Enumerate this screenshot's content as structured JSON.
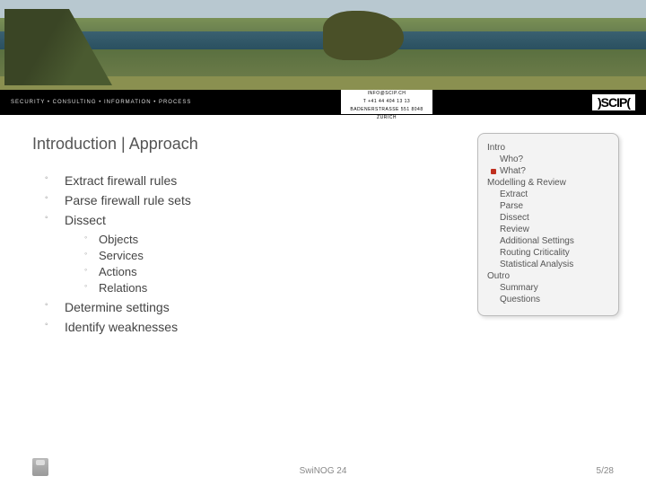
{
  "brand": {
    "tagline": "SECURITY • CONSULTING • INFORMATION • PROCESS",
    "line1": "INFO@SCIP.CH",
    "line2": "T +41 44 404 13 13",
    "line3": "BADENERSTRASSE 551 8048 ZÜRICH",
    "logo": ")SCIP("
  },
  "title": "Introduction | Approach",
  "bullets": {
    "b0": "Extract firewall rules",
    "b1": "Parse firewall rule sets",
    "b2": "Dissect",
    "b2s0": "Objects",
    "b2s1": "Services",
    "b2s2": "Actions",
    "b2s3": "Relations",
    "b3": "Determine settings",
    "b4": "Identify weaknesses"
  },
  "nav": {
    "s0": "Intro",
    "s0a": "Who?",
    "s0b": "What?",
    "s1": "Modelling & Review",
    "s1a": "Extract",
    "s1b": "Parse",
    "s1c": "Dissect",
    "s1d": "Review",
    "s1e": "Additional Settings",
    "s1f": "Routing Criticality",
    "s1g": "Statistical Analysis",
    "s2": "Outro",
    "s2a": "Summary",
    "s2b": "Questions"
  },
  "footer": {
    "event": "SwiNOG 24",
    "pager": "5/28"
  }
}
